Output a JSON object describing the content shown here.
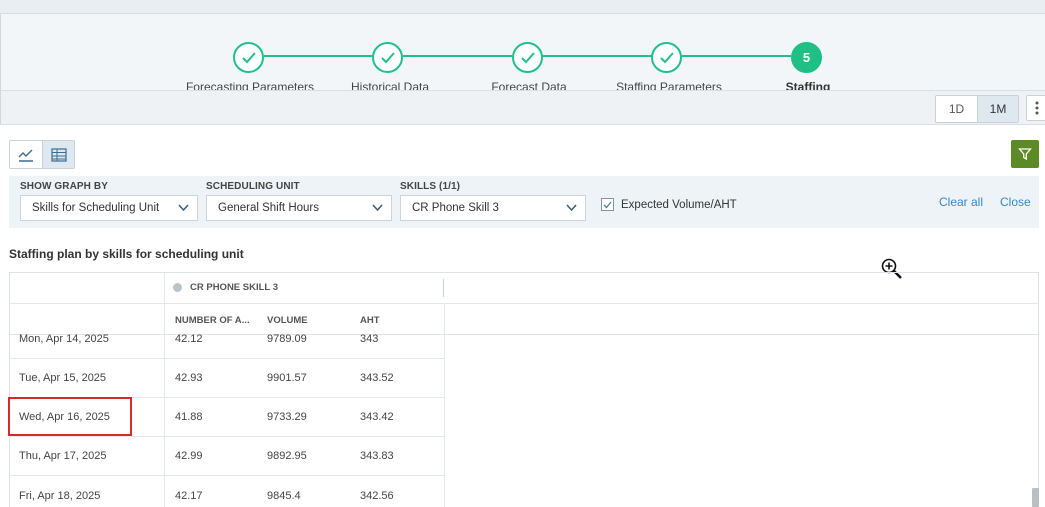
{
  "stepper": {
    "steps": [
      {
        "label": "Forecasting Parameters",
        "state": "done"
      },
      {
        "label": "Historical Data",
        "state": "done"
      },
      {
        "label": "Forecast Data",
        "state": "done"
      },
      {
        "label": "Staffing Parameters",
        "state": "done"
      },
      {
        "label": "Staffing",
        "state": "active",
        "number": "5"
      }
    ]
  },
  "range": {
    "options": [
      "1D",
      "1M"
    ],
    "selected": "1M"
  },
  "filters": {
    "show_graph_by": {
      "label": "SHOW GRAPH BY",
      "value": "Skills for Scheduling Unit"
    },
    "scheduling_unit": {
      "label": "SCHEDULING UNIT",
      "value": "General Shift Hours"
    },
    "skills": {
      "label": "SKILLS (1/1)",
      "value": "CR Phone Skill 3"
    },
    "expected_volume": {
      "label": "Expected Volume/AHT",
      "checked": true
    },
    "clear_all": "Clear all",
    "close": "Close"
  },
  "section_title": "Staffing plan by skills for scheduling unit",
  "table": {
    "skill_header": "CR PHONE SKILL 3",
    "columns": [
      "NUMBER OF A...",
      "VOLUME",
      "AHT"
    ],
    "rows": [
      {
        "date": "Mon, Apr 14, 2025",
        "agents": "42.12",
        "volume": "9789.09",
        "aht": "343"
      },
      {
        "date": "Tue, Apr 15, 2025",
        "agents": "42.93",
        "volume": "9901.57",
        "aht": "343.52"
      },
      {
        "date": "Wed, Apr 16, 2025",
        "agents": "41.88",
        "volume": "9733.29",
        "aht": "343.42"
      },
      {
        "date": "Thu, Apr 17, 2025",
        "agents": "42.99",
        "volume": "9892.95",
        "aht": "343.83"
      },
      {
        "date": "Fri, Apr 18, 2025",
        "agents": "42.17",
        "volume": "9845.4",
        "aht": "342.56"
      }
    ]
  },
  "colors": {
    "accent_green": "#1fbf86",
    "filter_green": "#5b8a26",
    "link_blue": "#3a86c2",
    "highlight_red": "#d42a2a"
  }
}
